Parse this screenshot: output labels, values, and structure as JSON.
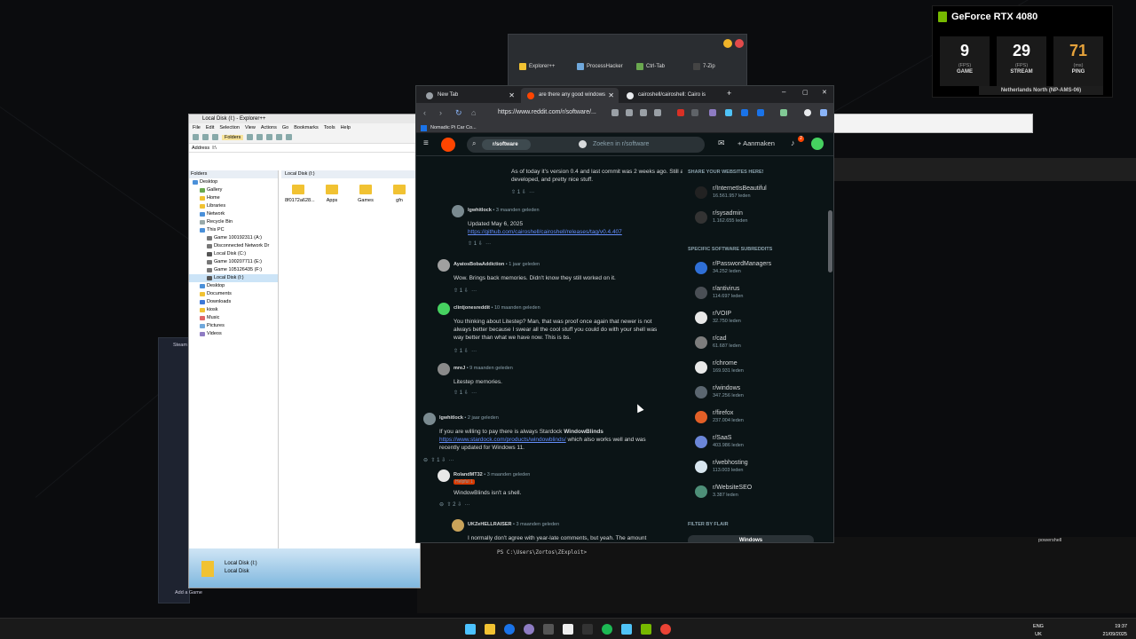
{
  "nvidia": {
    "title": "GeForce RTX 4080",
    "stats": [
      {
        "value": "9",
        "unit": "(FPS)",
        "label": "GAME"
      },
      {
        "value": "29",
        "unit": "(FPS)",
        "label": "STREAM"
      },
      {
        "value": "71",
        "unit": "(ms)",
        "label": "PING"
      }
    ],
    "server": "Netherlands North (NP-AMS-06)"
  },
  "alttab": {
    "items": [
      "Explorer++",
      "ProcessHacker",
      "Ctrl-Tab",
      "7-Zip"
    ]
  },
  "explorer": {
    "title": "Local Disk (I:) - Explorer++",
    "menu": [
      "File",
      "Edit",
      "Selection",
      "View",
      "Actions",
      "Go",
      "Bookmarks",
      "Tools",
      "Help"
    ],
    "folders_button": "Folders",
    "address_label": "Address",
    "address_value": "I:\\",
    "tree_header": "Folders",
    "tab_label": "Local Disk (I:)",
    "tree": [
      "Desktop",
      "Gallery",
      "Home",
      "Libraries",
      "Network",
      "Recycle Bin",
      "This PC",
      "Game 100192311 (A:)",
      "Disconnected Network Dr",
      "Local Disk (C:)",
      "Game 100207711 (E:)",
      "Game 105126435 (F:)",
      "Local Disk (I:)",
      "Desktop",
      "Documents",
      "Downloads",
      "kiosk",
      "Music",
      "Pictures",
      "Videos"
    ],
    "files": [
      "8f0172a628...",
      "Apps",
      "Games",
      "gfn"
    ],
    "footer_title": "Local Disk (I:)",
    "footer_sub": "Local Disk"
  },
  "steam": {
    "label": "Steam",
    "add_game": "Add a Game"
  },
  "browser": {
    "tabs": [
      {
        "label": "New Tab"
      },
      {
        "label": "are there any good windows"
      },
      {
        "label": "cairoshell/cairoshell: Cairo is"
      }
    ],
    "url": "https://www.reddit.com/r/software/...",
    "bookmark": "Nomadic Pi Car Co..."
  },
  "reddit": {
    "community_chip": "r/software",
    "search_placeholder": "Zoeken in r/software",
    "create_label": "Aanmaken",
    "notif_count": "2",
    "top_fragment": "As of today it's version 0.4 and last commit was 2 weeks ago. Still actively developed, and pretty nice stuff.",
    "top_votes": "1",
    "comments": [
      {
        "author": "lgwhitlock",
        "age": "3 maanden geleden",
        "body": "Updated May 6, 2025",
        "link": "https://github.com/cairoshell/cairoshell/releases/tag/v0.4.407",
        "votes": "1"
      },
      {
        "author": "AyatosBobaAddiction",
        "age": "1 jaar geleden",
        "body": "Wow. Brings back memories. Didn't know they still worked on it.",
        "votes": "1"
      },
      {
        "author": "clintjonesreddit",
        "age": "10 maanden geleden",
        "body": "You thinking about Litestep? Man, that was proof once again that newer is not always better because I swear all the cool stuff you could do with your shell was way better than what we have now. This is bs.",
        "votes": "1"
      },
      {
        "author": "mreJ",
        "age": "9 maanden geleden",
        "body": "Litestep memories.",
        "votes": "1"
      },
      {
        "author": "lgwhitlock",
        "age": "2 jaar geleden",
        "body_pre": "If you are willing to pay there is always Stardock ",
        "body_bold": "WindowBlinds",
        "link": "https://www.stardock.com/products/windowblinds/",
        "body_post": " which also works well and was recently updated for Windows 11.",
        "votes": "1"
      },
      {
        "author": "RolandMT32",
        "age": "3 maanden geleden",
        "badge": "Helpful 1",
        "body": "WindowBlinds isn't a shell.",
        "votes": "2"
      },
      {
        "author": "UKZeHELLRAISER",
        "age": "3 maanden geleden",
        "body": "I normally don't agree with year-late comments, but yeah. The amount"
      }
    ],
    "sidebar": {
      "header1": "SHARE YOUR WEBSITES HERE!",
      "top_subs": [
        {
          "name": "r/InternetIsBeautiful",
          "members": "16.561.957 leden"
        },
        {
          "name": "r/sysadmin",
          "members": "1.162.655 leden"
        }
      ],
      "header2": "SPECIFIC SOFTWARE SUBREDDITS",
      "subs": [
        {
          "name": "r/PasswordManagers",
          "members": "34.252 leden",
          "color": "#2f6fd6"
        },
        {
          "name": "r/antivirus",
          "members": "114.697 leden",
          "color": "#4a4f55"
        },
        {
          "name": "r/VOIP",
          "members": "32.750 leden",
          "color": "#e8e8e8"
        },
        {
          "name": "r/cad",
          "members": "61.687 leden",
          "color": "#7d7d7d"
        },
        {
          "name": "r/chrome",
          "members": "169.931 leden",
          "color": "#e9e9e9"
        },
        {
          "name": "r/windows",
          "members": "347.256 leden",
          "color": "#5b6670"
        },
        {
          "name": "r/firefox",
          "members": "237.004 leden",
          "color": "#e25f27"
        },
        {
          "name": "r/SaaS",
          "members": "403.986 leden",
          "color": "#6b86d8"
        },
        {
          "name": "r/webhosting",
          "members": "113.003 leden",
          "color": "#d8e6ef"
        },
        {
          "name": "r/WebsiteSEO",
          "members": "3.387 leden",
          "color": "#4e8f78"
        }
      ],
      "header3": "FILTER BY FLAIR",
      "flair": "Windows"
    }
  },
  "terminal": {
    "tab": "powershell",
    "prompt": "PS C:\\Users\\Zortos\\ZExploit>"
  },
  "tray": {
    "lang1": "ENG",
    "lang2": "UK",
    "time": "19:37",
    "date": "21/09/2025"
  }
}
